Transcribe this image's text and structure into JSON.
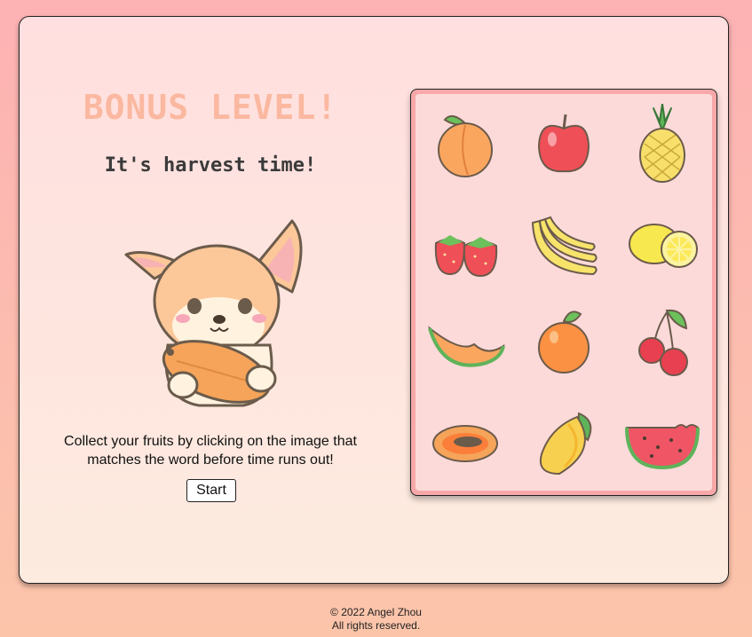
{
  "header": {
    "title": "BONUS LEVEL!",
    "subtitle": "It's harvest time!"
  },
  "instructions": "Collect your fruits by clicking on the image that matches the word before time runs out!",
  "start_label": "Start",
  "mascot_icon": "shiba-dog-holding-papaya-icon",
  "fruits": [
    {
      "icon": "peach-icon"
    },
    {
      "icon": "apple-icon"
    },
    {
      "icon": "pineapple-icon"
    },
    {
      "icon": "strawberry-icon"
    },
    {
      "icon": "banana-icon"
    },
    {
      "icon": "lemon-icon"
    },
    {
      "icon": "cantaloupe-icon"
    },
    {
      "icon": "orange-icon"
    },
    {
      "icon": "cherry-icon"
    },
    {
      "icon": "papaya-icon"
    },
    {
      "icon": "mango-icon"
    },
    {
      "icon": "watermelon-icon"
    }
  ],
  "footer": {
    "copyright": "© 2022 Angel Zhou",
    "rights": "All rights reserved."
  },
  "colors": {
    "title": "#fbb8a0",
    "panel_border": "#f8a8a8",
    "panel_bg": "#fddada"
  }
}
